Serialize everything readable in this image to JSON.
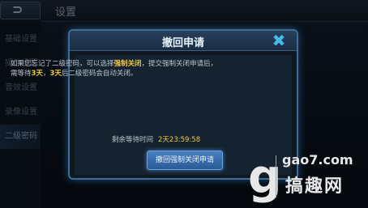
{
  "topbar": {
    "title": "设置",
    "back_glyph": "⊃"
  },
  "sidebar": {
    "items": [
      {
        "label": "基础设置",
        "active": false
      },
      {
        "label": "操作设置",
        "active": false
      },
      {
        "label": "音效设置",
        "active": false
      },
      {
        "label": "录像设置",
        "active": false
      },
      {
        "label": "二级密码",
        "active": true
      }
    ]
  },
  "dialog": {
    "title": "撤回申请",
    "close_glyph": "✖",
    "message": {
      "p1": "如果您忘记了二级密码，可以选择",
      "hl1": "强制关闭",
      "p2": "，提交强制关闭申请后，需等待",
      "hl2": "3天",
      "p3": "，",
      "hl3": "3天",
      "p4": "后二级密码会自动关闭。"
    },
    "wait_label": "剩余等待时间",
    "wait_value": "2天23:59:58",
    "revoke_button": "撤回强制关闭申请"
  },
  "watermark": {
    "glyph": "g",
    "url": "gao7.com",
    "name": "搞趣网"
  },
  "colors": {
    "accent": "#3d6e9a",
    "highlight": "#f0c83c",
    "button": "#4a7fc0"
  }
}
